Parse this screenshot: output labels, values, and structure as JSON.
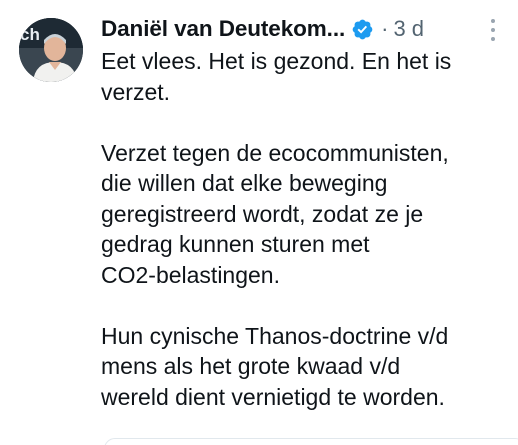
{
  "tweet": {
    "author_name": "Daniël van Deutekom...",
    "separator": "·",
    "time": "3 d",
    "verified_icon": "verified-badge-icon",
    "more_icon": "more-vertical-icon",
    "avatar_overlay_text": "ch",
    "paragraphs": [
      {
        "lines": [
          "Eet vlees. Het is gezond. En het is",
          "verzet."
        ]
      },
      {
        "lines": [
          "Verzet tegen de ecocommunisten,",
          "die willen dat elke beweging",
          "geregistreerd wordt, zodat ze je",
          "gedrag kunnen sturen met",
          "CO2-belastingen."
        ]
      },
      {
        "lines": [
          "Hun cynische Thanos-doctrine v/d",
          "mens als het grote kwaad v/d",
          "wereld dient vernietigd te worden."
        ]
      }
    ]
  },
  "colors": {
    "text": "#0f1419",
    "muted": "#536471",
    "verified": "#1d9bf0"
  }
}
